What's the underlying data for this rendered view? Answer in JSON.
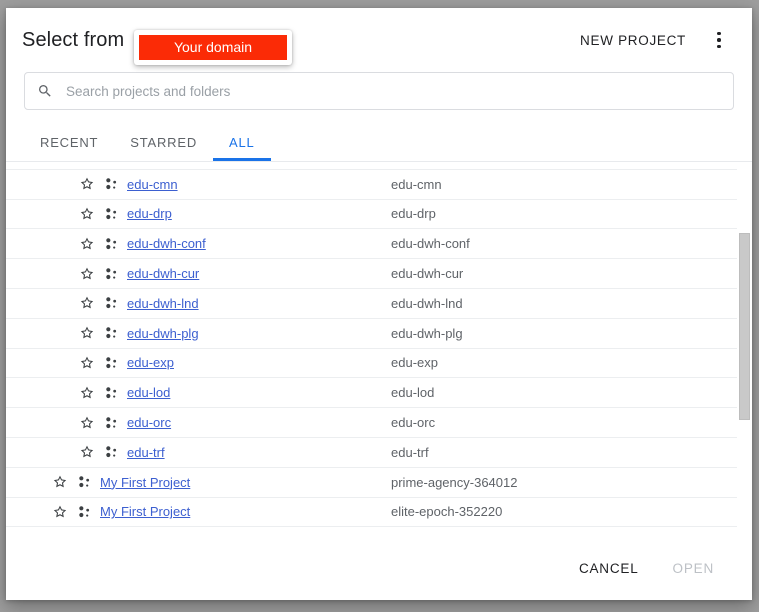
{
  "header": {
    "title": "Select from",
    "domain_chip": "Your domain",
    "domain_chip_color": "#fb2b06",
    "new_project_label": "NEW PROJECT",
    "more_menu_icon": "kebab-menu-icon"
  },
  "search": {
    "placeholder": "Search projects and folders",
    "value": "",
    "icon": "search-icon"
  },
  "tabs": [
    {
      "label": "RECENT",
      "active": false
    },
    {
      "label": "STARRED",
      "active": false
    },
    {
      "label": "ALL",
      "active": true
    }
  ],
  "accent_color": "#1a73e8",
  "link_color": "#3c5fd0",
  "annotation": {
    "highlight_row_name": "edu-orc",
    "box_color": "#e02020"
  },
  "rows": [
    {
      "name": "",
      "id": "",
      "depth": 1,
      "clipped": true
    },
    {
      "name": "edu-cmn",
      "id": "edu-cmn",
      "depth": 1
    },
    {
      "name": "edu-drp",
      "id": "edu-drp",
      "depth": 1
    },
    {
      "name": "edu-dwh-conf",
      "id": "edu-dwh-conf",
      "depth": 1
    },
    {
      "name": "edu-dwh-cur",
      "id": "edu-dwh-cur",
      "depth": 1
    },
    {
      "name": "edu-dwh-lnd",
      "id": "edu-dwh-lnd",
      "depth": 1
    },
    {
      "name": "edu-dwh-plg",
      "id": "edu-dwh-plg",
      "depth": 1
    },
    {
      "name": "edu-exp",
      "id": "edu-exp",
      "depth": 1
    },
    {
      "name": "edu-lod",
      "id": "edu-lod",
      "depth": 1
    },
    {
      "name": "edu-orc",
      "id": "edu-orc",
      "depth": 1,
      "highlighted": true
    },
    {
      "name": "edu-trf",
      "id": "edu-trf",
      "depth": 1
    },
    {
      "name": "My First Project",
      "id": "prime-agency-364012",
      "depth": 0
    },
    {
      "name": "My First Project",
      "id": "elite-epoch-352220",
      "depth": 0
    }
  ],
  "footer": {
    "cancel_label": "CANCEL",
    "open_label": "OPEN",
    "open_disabled": true
  },
  "scrollbar": {
    "thumb_top_pct": 19,
    "thumb_height_pct": 50
  }
}
